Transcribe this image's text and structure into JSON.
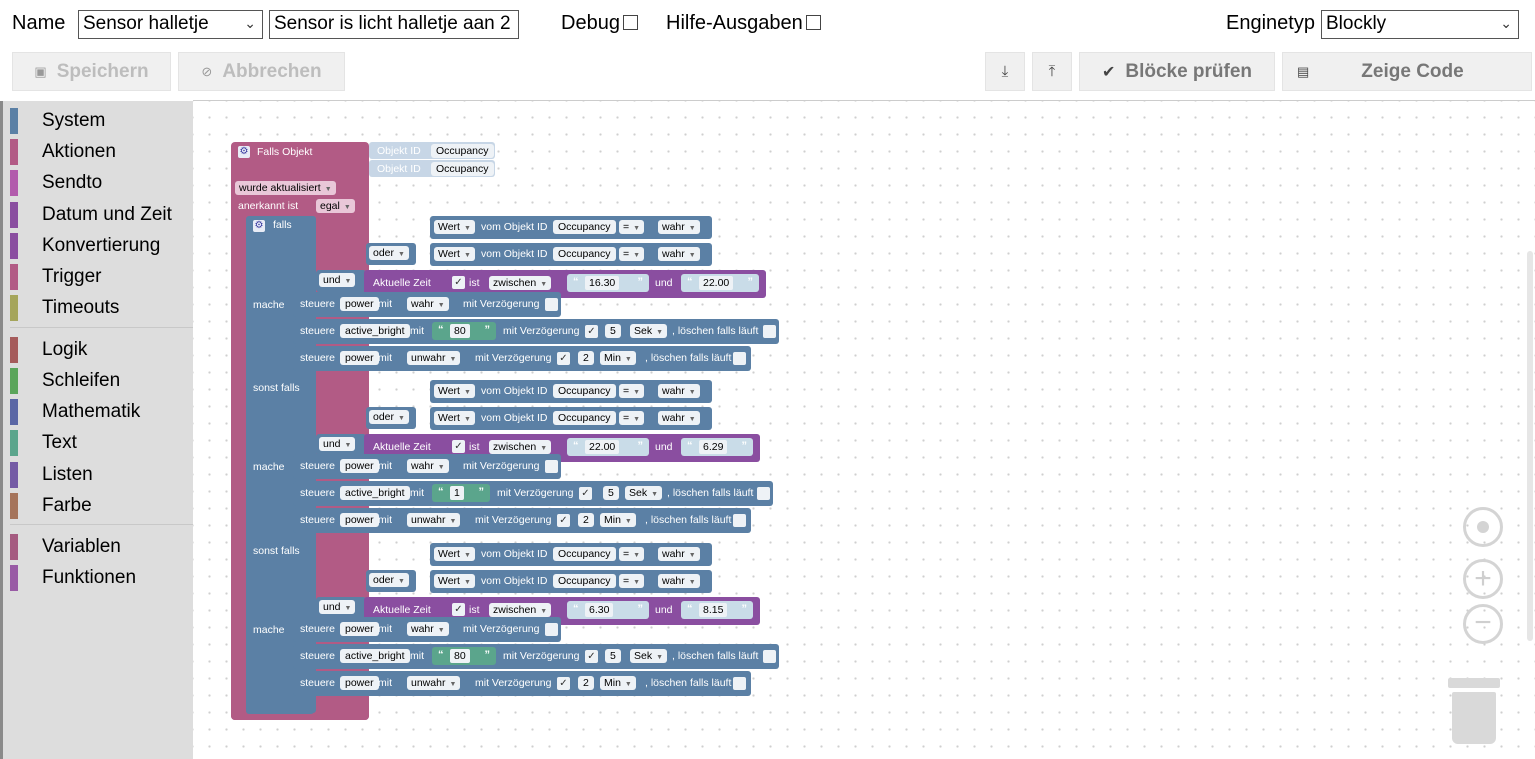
{
  "header": {
    "name_label": "Name",
    "name_value": "Sensor halletje",
    "description_value": "Sensor is licht halletje aan 2",
    "debug_label": "Debug",
    "hints_label": "Hilfe-Ausgaben",
    "engine_label": "Enginetyp",
    "engine_value": "Blockly"
  },
  "toolbar": {
    "save_label": "Speichern",
    "cancel_label": "Abbrechen",
    "check_label": "Blöcke prüfen",
    "show_code_label": "Zeige Code",
    "export_icon": "download-icon",
    "import_icon": "upload-icon"
  },
  "sidebar": {
    "categories": [
      {
        "label": "System",
        "color": "#5b80a5"
      },
      {
        "label": "Aktionen",
        "color": "#b25b85"
      },
      {
        "label": "Sendto",
        "color": "#b25bac"
      },
      {
        "label": "Datum und Zeit",
        "color": "#8a4ea0"
      },
      {
        "label": "Konvertierung",
        "color": "#8a4ea0"
      },
      {
        "label": "Trigger",
        "color": "#b25b85"
      },
      {
        "label": "Timeouts",
        "color": "#a5a55b"
      },
      {
        "label": "Logik",
        "color": "#a55b5b"
      },
      {
        "label": "Schleifen",
        "color": "#5ba55b"
      },
      {
        "label": "Mathematik",
        "color": "#5b67a5"
      },
      {
        "label": "Text",
        "color": "#5ba58c"
      },
      {
        "label": "Listen",
        "color": "#745ba5"
      },
      {
        "label": "Farbe",
        "color": "#a5745b"
      },
      {
        "label": "Variablen",
        "color": "#a55b80"
      },
      {
        "label": "Funktionen",
        "color": "#995ba5"
      }
    ]
  },
  "blocks": {
    "event_title": "Falls Objekt",
    "obj_id_label": "Objekt ID",
    "obj_id_value": "Occupancy",
    "updated_label": "wurde aktualisiert",
    "ack_label": "anerkannt ist",
    "ack_value": "egal",
    "falls_label": "falls",
    "mache_label": "mache",
    "sonst_falls_label": "sonst falls",
    "oder_label": "oder",
    "und_label": "und",
    "wert_label": "Wert",
    "vom_obj_label": "vom Objekt ID",
    "occupancy": "Occupancy",
    "eq": "=",
    "wahr": "wahr",
    "unwahr": "unwahr",
    "aktuelle_zeit": "Aktuelle Zeit",
    "ist": "ist",
    "zwischen": "zwischen",
    "und_small": "und",
    "steuere": "steuere",
    "power": "power",
    "active_bright": "active_bright",
    "mit": "mit",
    "mit_verz": "mit Verzögerung",
    "sek": "Sek",
    "min": "Min",
    "loeschen": ", löschen falls läuft",
    "five": "5",
    "two": "2",
    "branch1": {
      "from": "16.30",
      "to": "22.00",
      "bright": "80"
    },
    "branch2": {
      "from": "22.00",
      "to": "6.29",
      "bright": "1"
    },
    "branch3": {
      "from": "6.30",
      "to": "8.15",
      "bright": "80"
    }
  },
  "workspace_controls": {
    "center_icon": "target-icon",
    "zoom_in_icon": "plus-icon",
    "zoom_out_icon": "minus-icon",
    "trash_icon": "trash-icon"
  }
}
